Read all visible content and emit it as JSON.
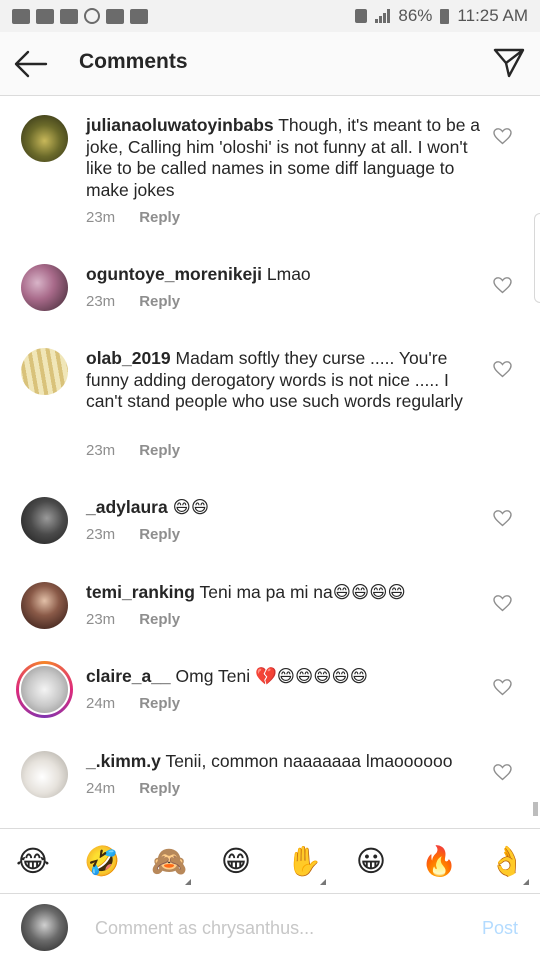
{
  "status_bar": {
    "battery": "86%",
    "time": "11:25 AM"
  },
  "header": {
    "title": "Comments",
    "back_icon": "arrow-left-icon",
    "send_icon": "paper-plane-icon"
  },
  "comments": [
    {
      "username": "julianaoluwatoyinbabs",
      "text": "Though, it's meant to be a joke, Calling him 'oloshi' is not funny at all.  I won't like to be called names in some diff language to make jokes",
      "time": "23m",
      "reply": "Reply"
    },
    {
      "username": "oguntoye_morenikeji",
      "text": "Lmao",
      "time": "23m",
      "reply": "Reply"
    },
    {
      "username": "olab_2019",
      "text": "Madam softly they curse ..... You're funny adding derogatory words is not nice ..... I can't stand people who use such words regularly",
      "time": "23m",
      "reply": "Reply"
    },
    {
      "username": "_adylaura",
      "text": "😄😄",
      "time": "23m",
      "reply": "Reply"
    },
    {
      "username": "temi_ranking",
      "text": "Teni ma pa mi na😄😄😄😄",
      "time": "23m",
      "reply": "Reply"
    },
    {
      "username": "claire_a__",
      "text": "Omg Teni 💔😄😄😄😄😄",
      "time": "24m",
      "reply": "Reply"
    },
    {
      "username": "_.kimm.y",
      "text": "Tenii, common naaaaaaa lmaoooooo",
      "time": "24m",
      "reply": "Reply"
    }
  ],
  "emoji_bar": [
    "😂",
    "🤣",
    "🙈",
    "😁",
    "✋",
    "😀",
    "🔥",
    "👌"
  ],
  "input": {
    "placeholder": "Comment as chrysanthus...",
    "post_label": "Post"
  },
  "colors": {
    "text": "#262626",
    "secondary": "#8e8e8e",
    "post_disabled": "#b3dbff",
    "divider": "#dbdbdb"
  }
}
